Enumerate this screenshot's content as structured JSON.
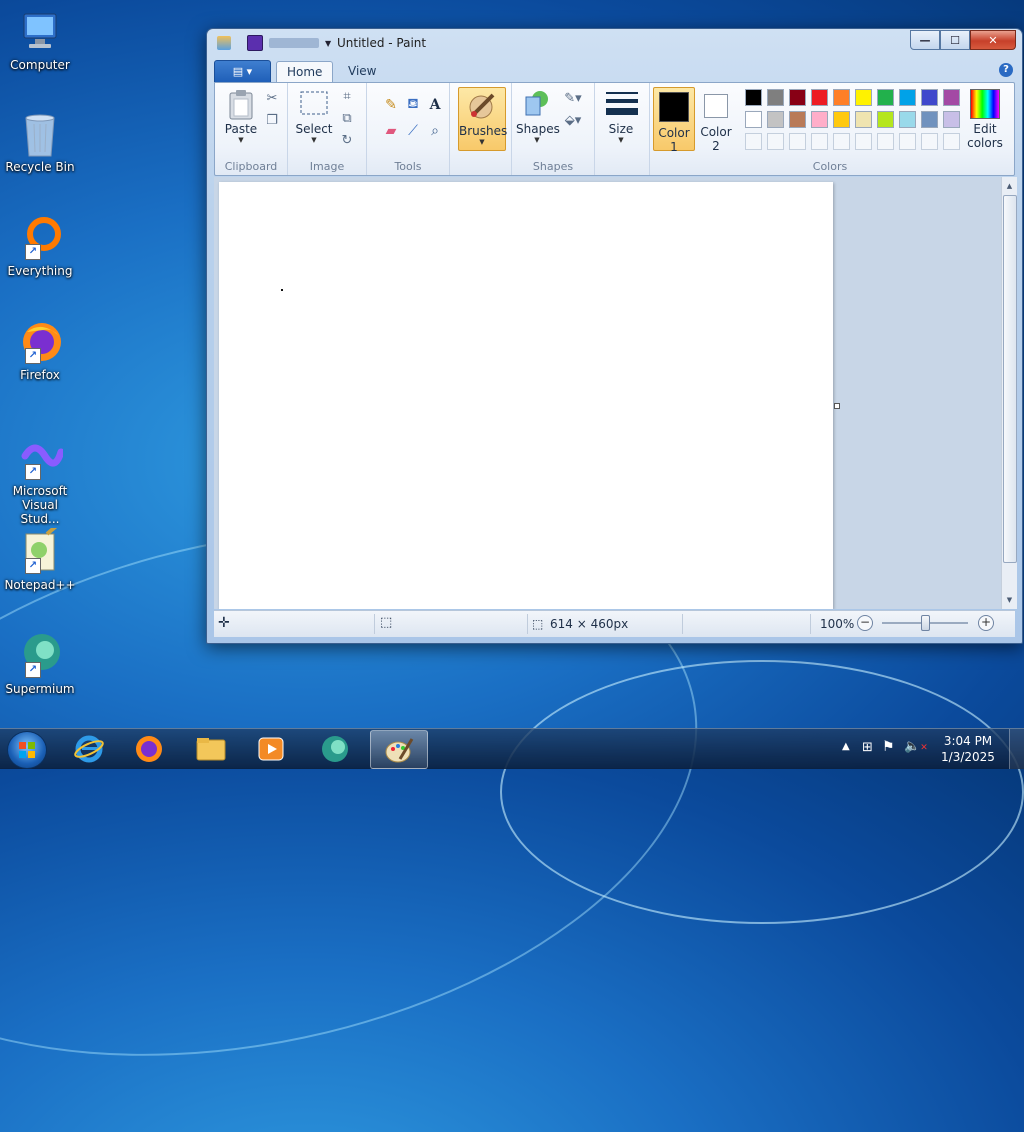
{
  "desktop": {
    "icons": [
      {
        "label": "Computer"
      },
      {
        "label": "Recycle Bin"
      },
      {
        "label": "Everything"
      },
      {
        "label": "Firefox"
      },
      {
        "label": "Microsoft Visual Stud..."
      },
      {
        "label": "Notepad++"
      },
      {
        "label": "Supermium"
      }
    ]
  },
  "window": {
    "title": "Untitled - Paint",
    "buttons": {
      "minimize": "—",
      "maximize": "☐",
      "close": "✕"
    },
    "tabs": [
      {
        "label": "Home"
      },
      {
        "label": "View"
      }
    ],
    "help": "?",
    "ribbon": {
      "clipboard": {
        "paste": "Paste",
        "group": "Clipboard"
      },
      "image": {
        "select": "Select",
        "group": "Image"
      },
      "tools": {
        "group": "Tools"
      },
      "brushes": {
        "label": "Brushes"
      },
      "shapes": {
        "label": "Shapes",
        "group": "Shapes"
      },
      "size": {
        "label": "Size"
      },
      "color1": {
        "line1": "Color",
        "line2": "1"
      },
      "color2": {
        "line1": "Color",
        "line2": "2"
      },
      "colors_group": "Colors",
      "edit_colors": {
        "line1": "Edit",
        "line2": "colors"
      },
      "palette_row1": [
        "#000000",
        "#7f7f7f",
        "#880015",
        "#ed1c24",
        "#ff7f27",
        "#fff200",
        "#22b14c",
        "#00a2e8",
        "#3f48cc",
        "#a349a4"
      ],
      "palette_row2": [
        "#ffffff",
        "#c3c3c3",
        "#b97a57",
        "#ffaec9",
        "#ffc90e",
        "#efe4b0",
        "#b5e61d",
        "#99d9ea",
        "#7092be",
        "#c8bfe7"
      ],
      "color1_value": "#000000",
      "color2_value": "#ffffff"
    },
    "statusbar": {
      "dimensions": "614 × 460px",
      "zoom": "100%",
      "zoom_level": 0.5
    }
  },
  "taskbar": {
    "time": "3:04 PM",
    "date": "1/3/2025"
  }
}
